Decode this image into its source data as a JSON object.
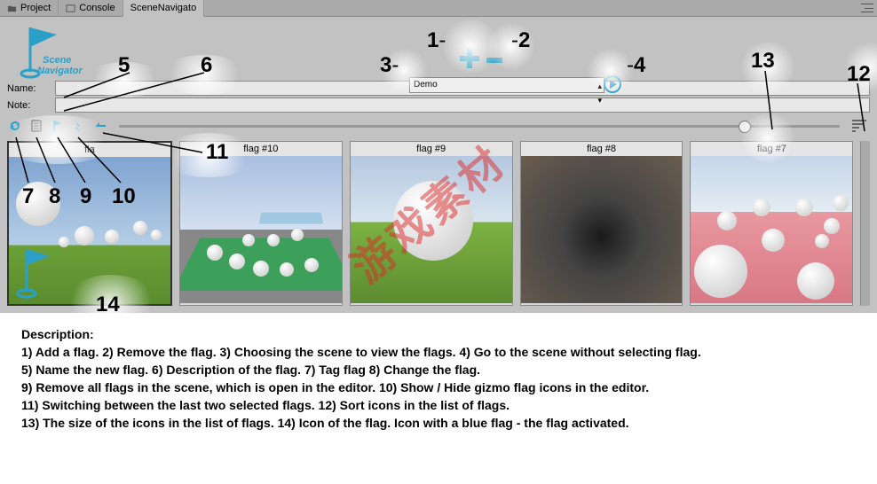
{
  "tabs": {
    "project": "Project",
    "console": "Console",
    "scene_nav": "SceneNavigato"
  },
  "logo_text": "Scene Navigator",
  "scene_select": {
    "value": "Demo"
  },
  "fields": {
    "name_label": "Name:",
    "note_label": "Note:",
    "name_value": "",
    "note_value": ""
  },
  "thumbs": [
    {
      "title": "fla",
      "selected": true
    },
    {
      "title": "flag #10",
      "selected": false
    },
    {
      "title": "flag #9",
      "selected": false
    },
    {
      "title": "flag #8",
      "selected": false
    },
    {
      "title": "flag #7",
      "selected": false
    }
  ],
  "callouts": {
    "c1": "1",
    "c2": "2",
    "c3": "3",
    "c4": "4",
    "c5": "5",
    "c6": "6",
    "c7": "7",
    "c8": "8",
    "c9": "9",
    "c10": "10",
    "c11": "11",
    "c12": "12",
    "c13": "13",
    "c14": "14"
  },
  "description": {
    "heading": "Description:",
    "line1": "1) Add a flag. 2) Remove the flag. 3) Choosing the scene to view the flags. 4) Go to the scene without selecting flag.",
    "line2": "5) Name the new flag. 6) Description of the flag. 7) Tag flag 8) Change the flag.",
    "line3": "9) Remove all flags in the scene, which is open in the editor. 10) Show / Hide gizmo flag icons in the editor.",
    "line4": "11) Switching between the last two selected flags. 12) Sort icons in the list of flags.",
    "line5": "13) The size of the icons in the list of flags. 14) Icon of the flag. Icon with a blue flag - the flag activated."
  },
  "watermark": "游戏素材",
  "icons": {
    "refresh": "refresh-icon",
    "delete": "trash-icon",
    "flag": "flag-icon",
    "bolt": "bolt-icon",
    "plus": "plus-icon",
    "minus": "minus-icon",
    "play": "play-icon",
    "sort": "sort-icon"
  }
}
